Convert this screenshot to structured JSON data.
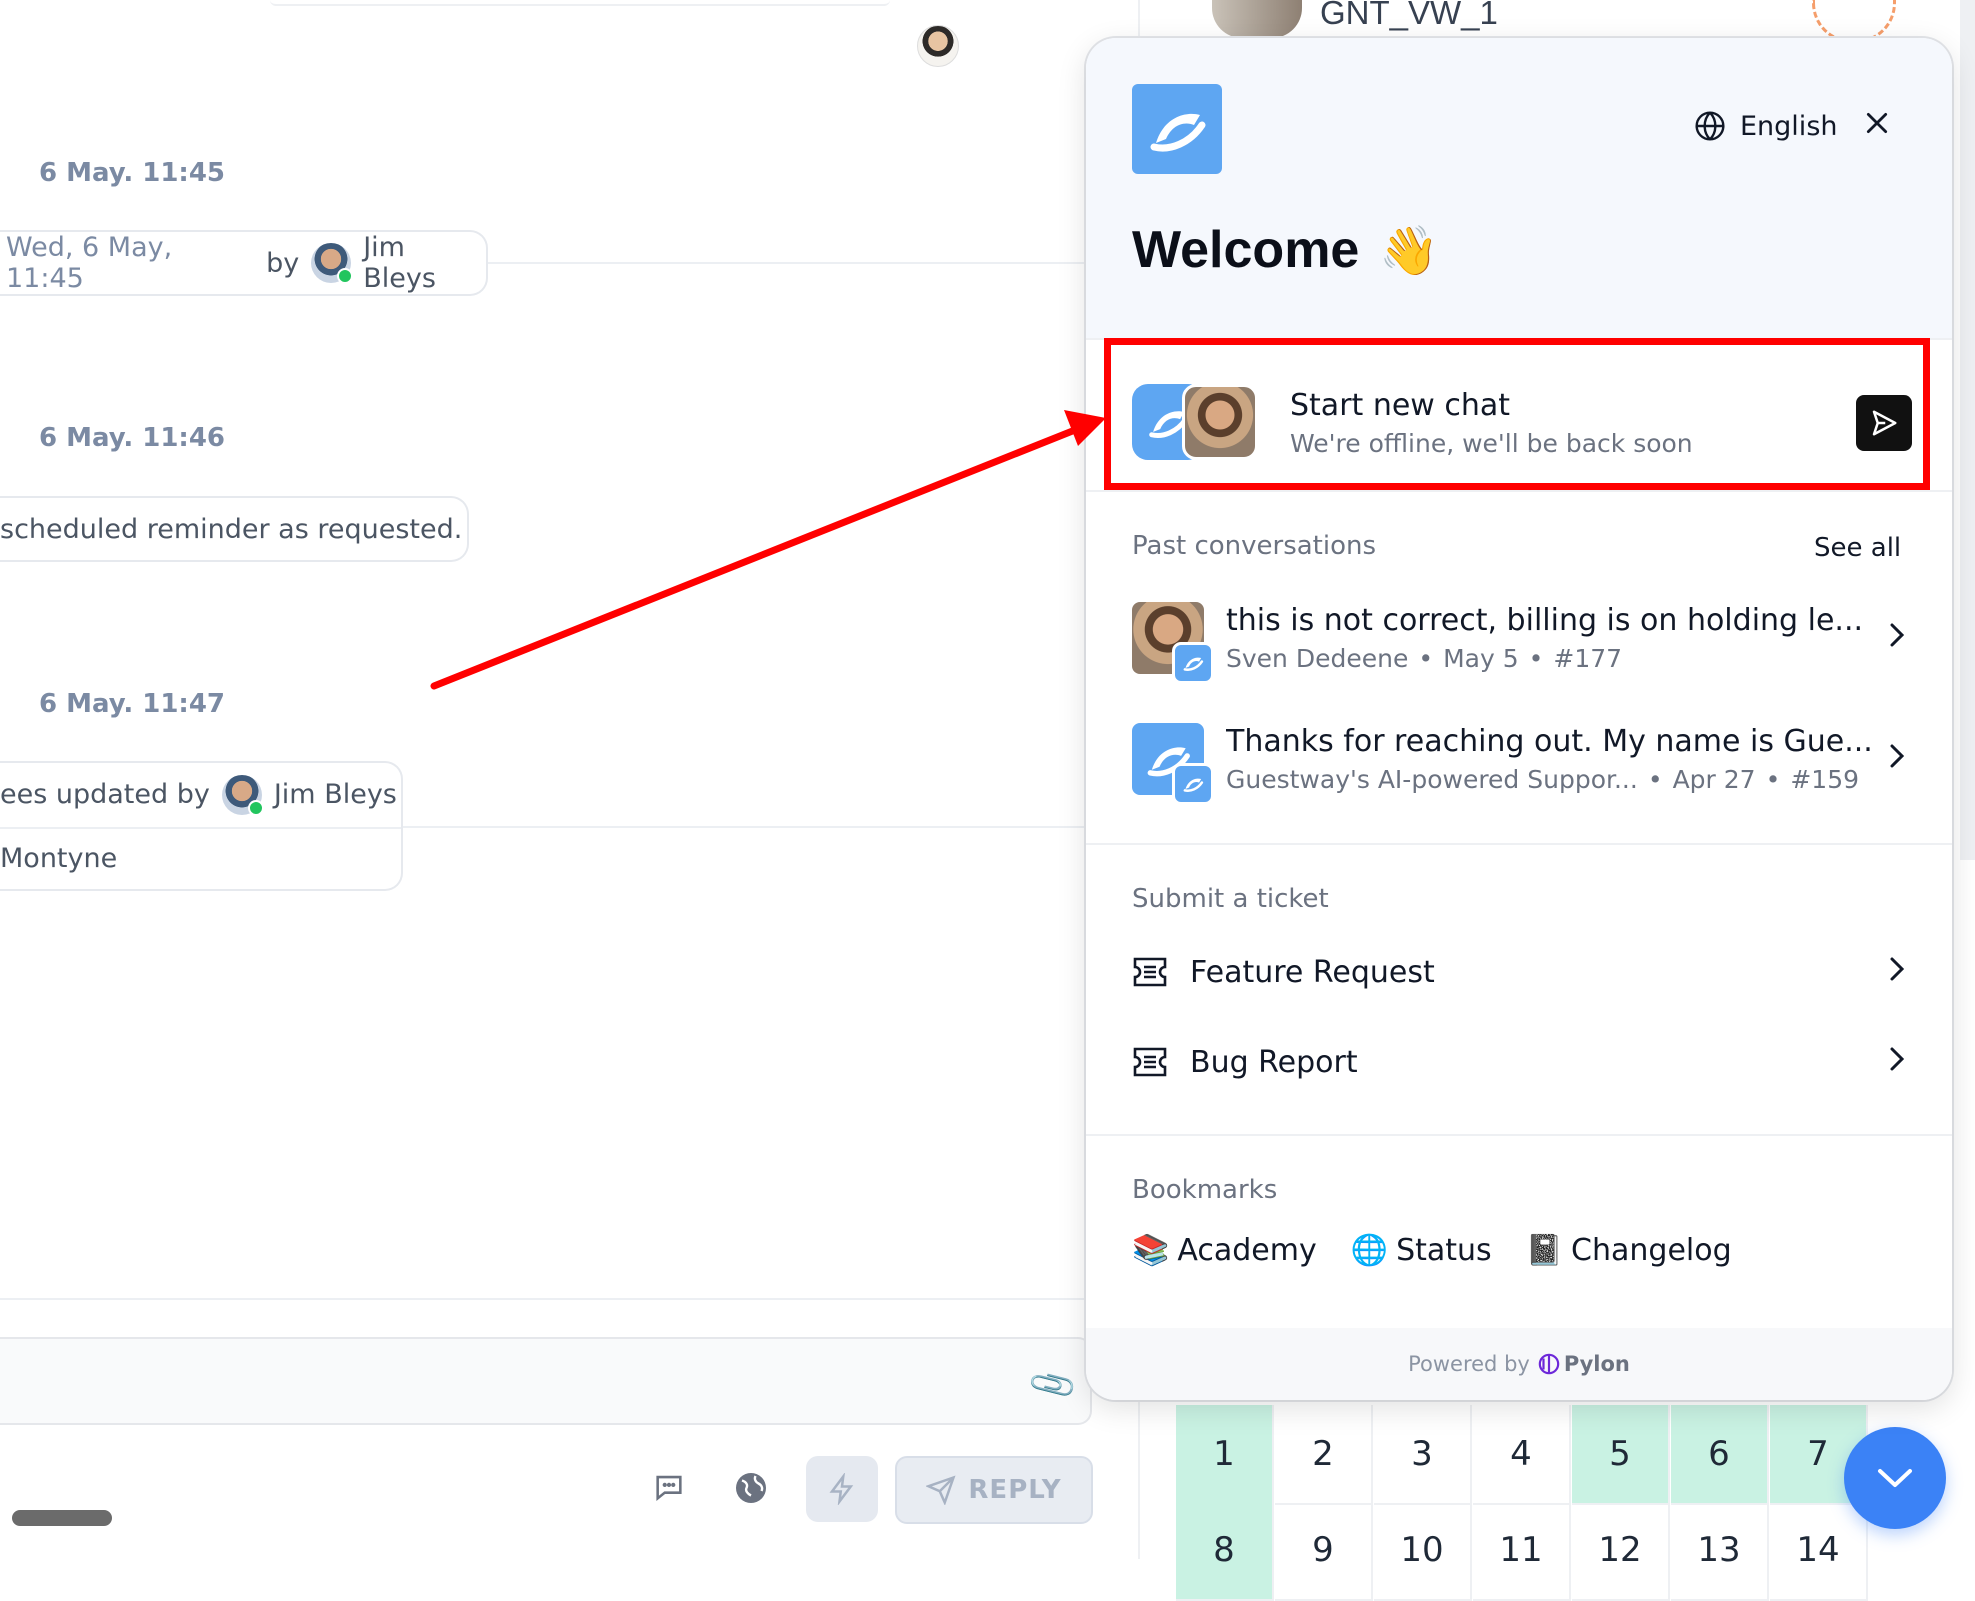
{
  "background": {
    "timestamps": [
      "6 May. 11:45",
      "6 May. 11:46",
      "6 May. 11:47"
    ],
    "event1": {
      "prefix": "Wed, 6 May, 11:45",
      "by": "by",
      "user": "Jim Bleys"
    },
    "reminder_text": "scheduled reminder as requested.",
    "event3": {
      "prefix": "ees updated by",
      "user": "Jim Bleys",
      "detail": "Montyne"
    },
    "reply_label": "REPLY",
    "right_title": "GNT_VW_1",
    "calendar_days": [
      "1",
      "2",
      "3",
      "4",
      "5",
      "6",
      "7",
      "8",
      "9",
      "10",
      "11",
      "12",
      "13",
      "14"
    ],
    "calendar_highlighted": [
      1,
      5,
      6,
      7,
      8
    ]
  },
  "widget": {
    "language": "English",
    "welcome": "Welcome",
    "wave_emoji": "👋",
    "start_chat": {
      "title": "Start new chat",
      "subtitle": "We're offline, we'll be back soon"
    },
    "past": {
      "title": "Past conversations",
      "see_all": "See all",
      "items": [
        {
          "title": "this is not correct, billing is on holding le...",
          "author": "Sven Dedeene",
          "date": "May 5",
          "id": "#177"
        },
        {
          "title": "Thanks for reaching out. My name is Gue...",
          "author": "Guestway's AI-powered Suppor...",
          "date": "Apr 27",
          "id": "#159"
        }
      ]
    },
    "ticket": {
      "title": "Submit a ticket",
      "items": [
        "Feature Request",
        "Bug Report"
      ]
    },
    "bookmarks": {
      "title": "Bookmarks",
      "items": [
        {
          "emoji": "📚",
          "label": "Academy"
        },
        {
          "emoji": "🌐",
          "label": "Status"
        },
        {
          "emoji": "📓",
          "label": "Changelog"
        }
      ]
    },
    "powered_by": "Powered by",
    "powered_brand": "Pylon"
  },
  "colors": {
    "accent": "#5ea6f2",
    "annotation": "#ff0000",
    "fab": "#3b82f6",
    "calendar_highlight": "#c9f2e3"
  }
}
